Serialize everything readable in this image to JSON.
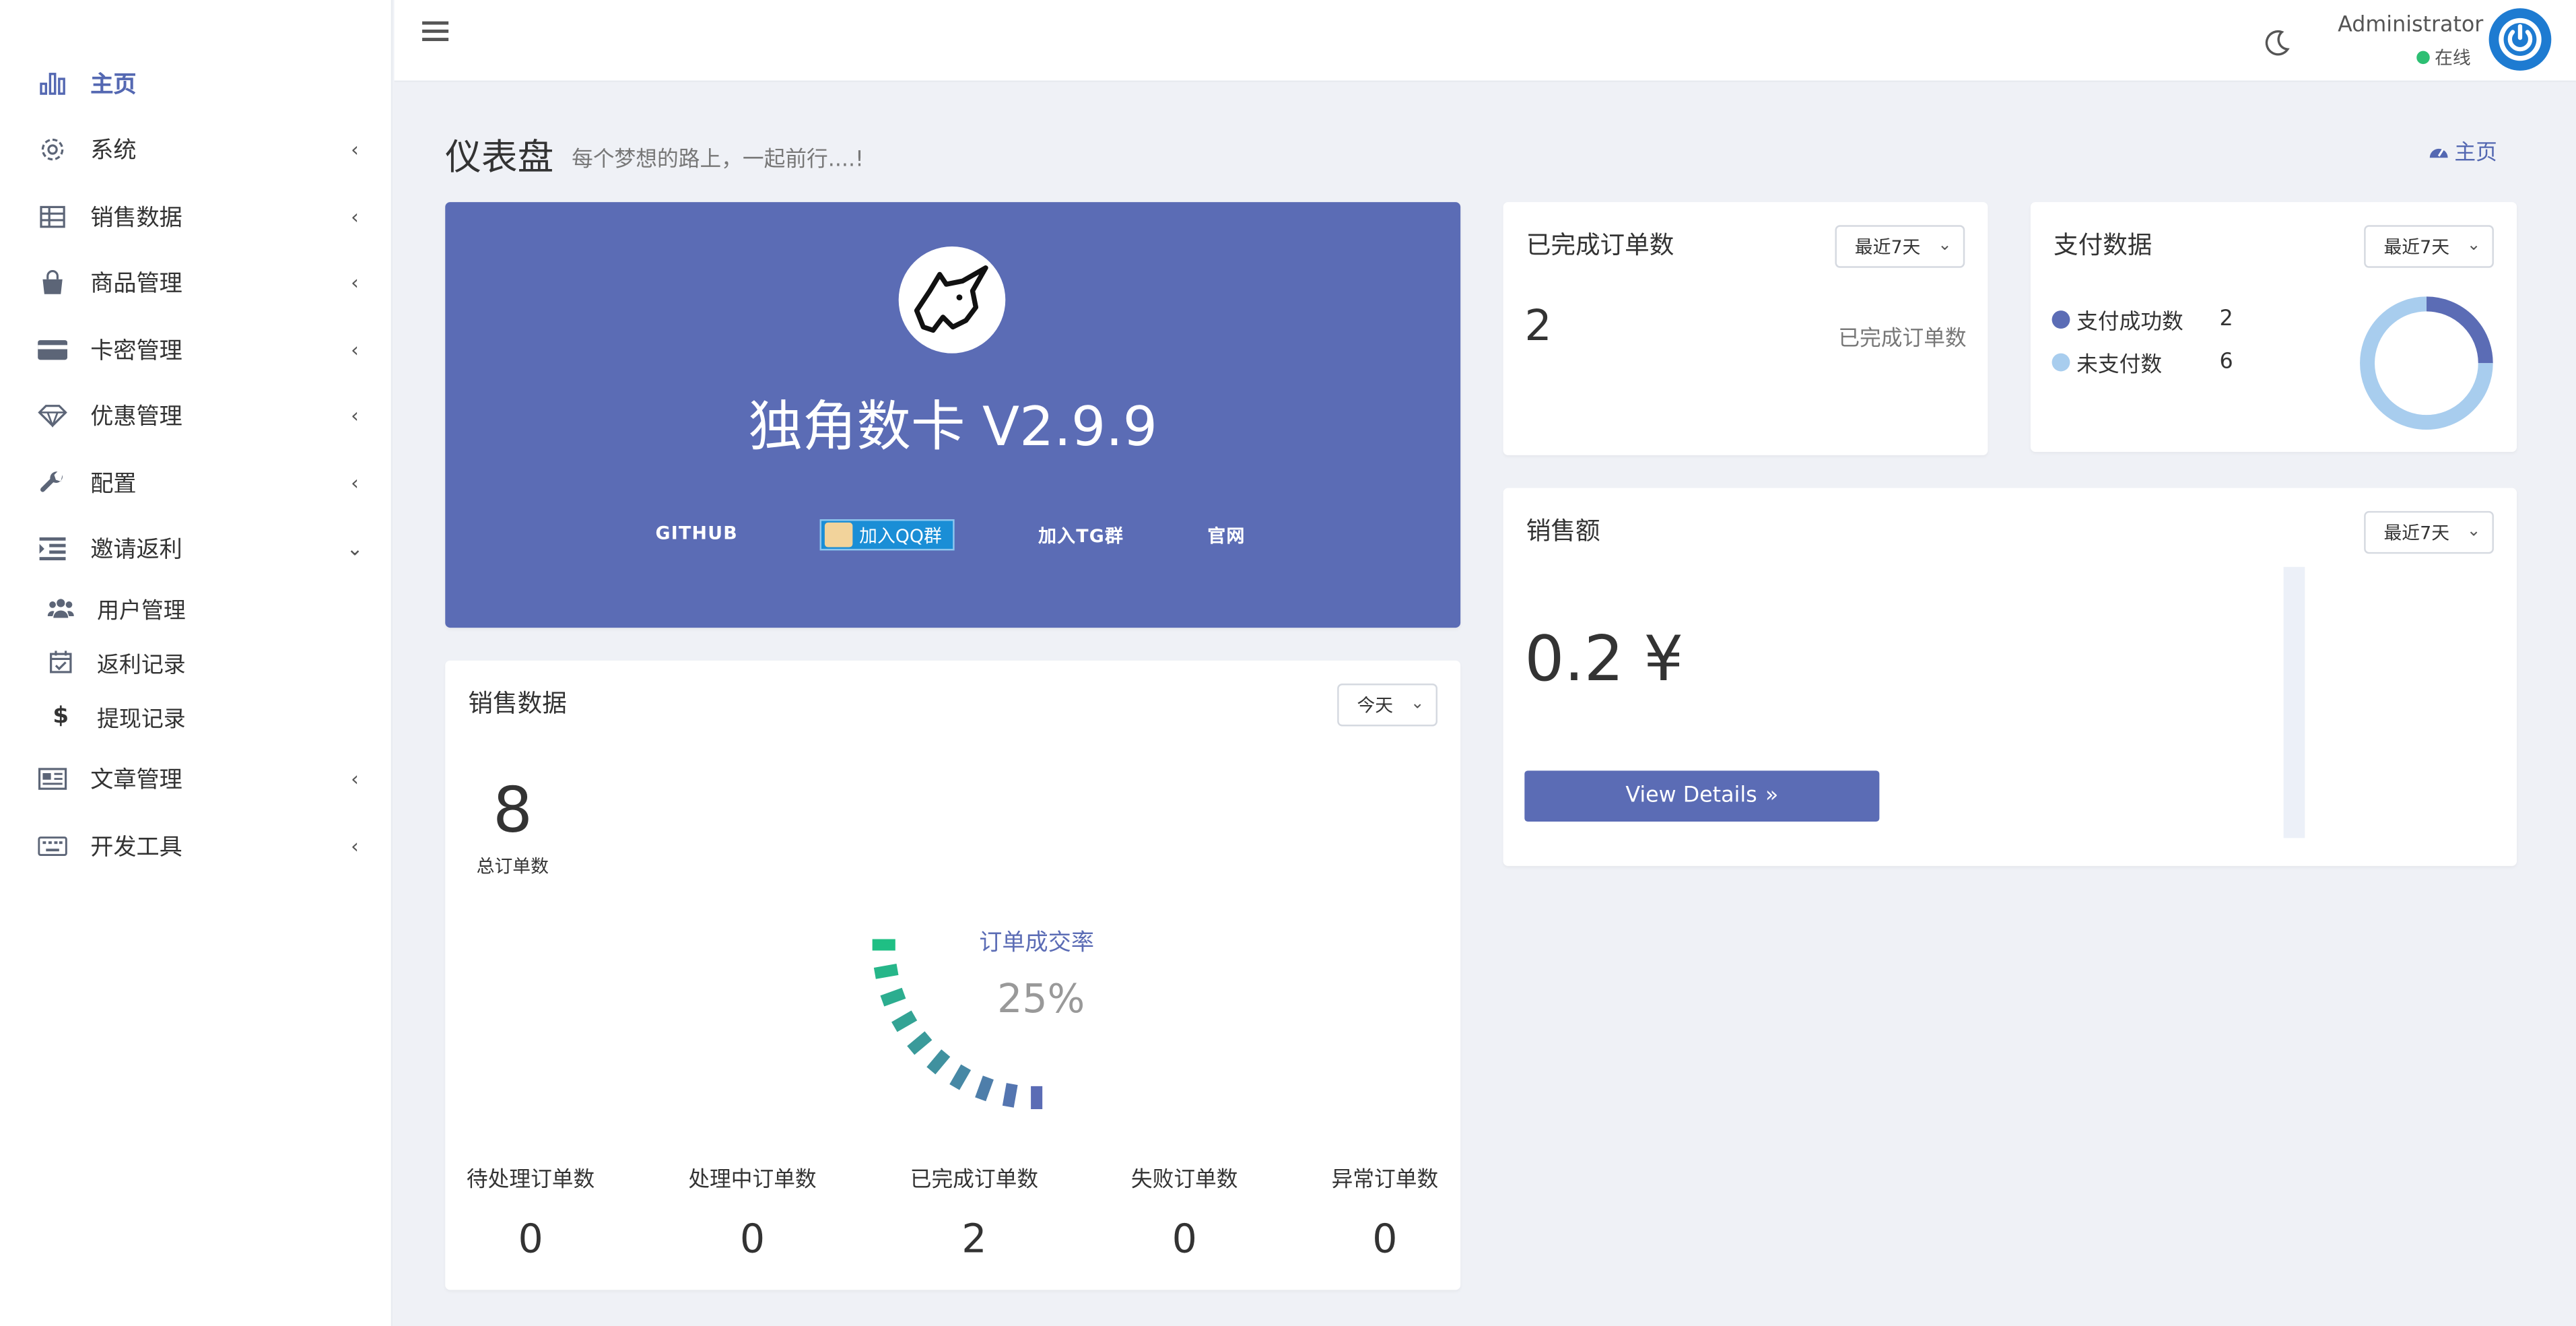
{
  "sidebar": {
    "items": [
      {
        "label": "主页",
        "icon": "bar-chart-icon"
      },
      {
        "label": "系统",
        "icon": "gear-icon"
      },
      {
        "label": "销售数据",
        "icon": "table-icon"
      },
      {
        "label": "商品管理",
        "icon": "shopping-bag-icon"
      },
      {
        "label": "卡密管理",
        "icon": "credit-card-icon"
      },
      {
        "label": "优惠管理",
        "icon": "gem-icon"
      },
      {
        "label": "配置",
        "icon": "wrench-icon"
      },
      {
        "label": "邀请返利",
        "icon": "indent-icon"
      },
      {
        "label": "文章管理",
        "icon": "newspaper-icon"
      },
      {
        "label": "开发工具",
        "icon": "keyboard-icon"
      }
    ],
    "subitems": [
      {
        "label": "用户管理",
        "icon": "users-icon"
      },
      {
        "label": "返利记录",
        "icon": "calendar-check-icon"
      },
      {
        "label": "提现记录",
        "icon": "dollar-icon"
      }
    ]
  },
  "header": {
    "user_name": "Administrator",
    "status": "在线"
  },
  "page": {
    "title": "仪表盘",
    "subtitle": "每个梦想的路上，一起前行....!",
    "breadcrumb": "主页"
  },
  "hero": {
    "title": "独角数卡 V2.9.9",
    "links": [
      "GITHUB",
      "加入QQ群",
      "加入TG群",
      "官网"
    ]
  },
  "completed_orders": {
    "title": "已完成订单数",
    "range": "最近7天",
    "value": "2",
    "label": "已完成订单数"
  },
  "payment": {
    "title": "支付数据",
    "range": "最近7天",
    "legend": [
      {
        "name": "支付成功数",
        "value": "2",
        "color": "#5b6cb5"
      },
      {
        "name": "未支付数",
        "value": "6",
        "color": "#a8cdee"
      }
    ]
  },
  "sales_amount": {
    "title": "销售额",
    "range": "最近7天",
    "value": "0.2 ¥",
    "button": "View Details"
  },
  "sales_data": {
    "title": "销售数据",
    "range": "今天",
    "total": "8",
    "total_label": "总订单数",
    "rate_label": "订单成交率",
    "rate": "25%",
    "rate_value": 0.25,
    "stats": [
      {
        "label": "待处理订单数",
        "value": "0"
      },
      {
        "label": "处理中订单数",
        "value": "0"
      },
      {
        "label": "已完成订单数",
        "value": "2"
      },
      {
        "label": "失败订单数",
        "value": "0"
      },
      {
        "label": "异常订单数",
        "value": "0"
      }
    ]
  },
  "chart_data": {
    "type": "pie",
    "categories": [
      "支付成功数",
      "未支付数"
    ],
    "values": [
      2,
      6
    ]
  },
  "colors": {
    "accent": "#5b6cb5",
    "online": "#2dbf73",
    "gauge_start": "#1fbf84",
    "gauge_end": "#5b6cb5"
  }
}
